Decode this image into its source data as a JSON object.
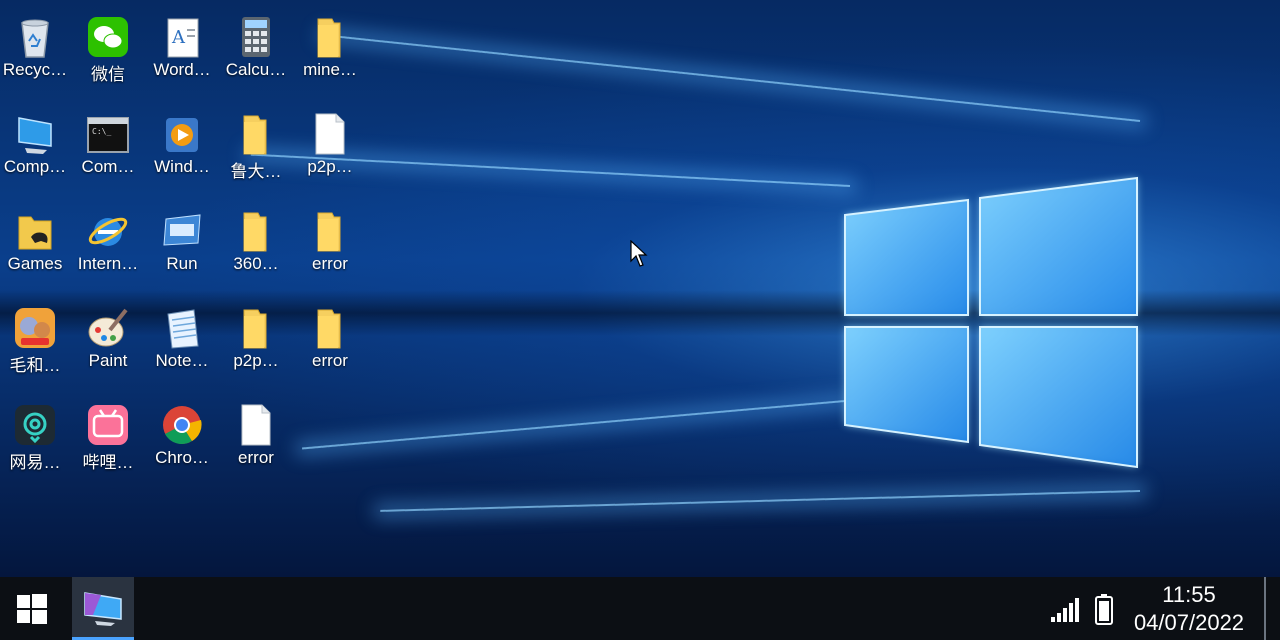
{
  "desktop": {
    "icons": [
      {
        "label": "Recyc…",
        "icon": "recycle-bin-icon"
      },
      {
        "label": "微信",
        "icon": "wechat-icon"
      },
      {
        "label": "Word…",
        "icon": "wordpad-icon"
      },
      {
        "label": "Calcu…",
        "icon": "calculator-icon"
      },
      {
        "label": "mine…",
        "icon": "folder-icon"
      },
      {
        "label": "Comp…",
        "icon": "computer-icon"
      },
      {
        "label": "Com…",
        "icon": "command-prompt-icon"
      },
      {
        "label": "Wind…",
        "icon": "media-player-icon"
      },
      {
        "label": "鲁大…",
        "icon": "folder-icon"
      },
      {
        "label": "p2p…",
        "icon": "document-icon"
      },
      {
        "label": "Games",
        "icon": "games-folder-icon"
      },
      {
        "label": "Intern…",
        "icon": "internet-explorer-icon"
      },
      {
        "label": "Run",
        "icon": "run-icon"
      },
      {
        "label": "360…",
        "icon": "folder-icon"
      },
      {
        "label": "error",
        "icon": "folder-icon"
      },
      {
        "label": "毛和…",
        "icon": "tom-jerry-game-icon"
      },
      {
        "label": "Paint",
        "icon": "paint-icon"
      },
      {
        "label": "Note…",
        "icon": "notepad-icon"
      },
      {
        "label": "p2p…",
        "icon": "folder-icon"
      },
      {
        "label": "error",
        "icon": "folder-icon"
      },
      {
        "label": "网易…",
        "icon": "netease-icon"
      },
      {
        "label": "哔哩…",
        "icon": "bilibili-icon"
      },
      {
        "label": "Chro…",
        "icon": "chrome-icon"
      },
      {
        "label": "error",
        "icon": "document-icon"
      }
    ]
  },
  "taskbar": {
    "start_icon": "windows-start-icon",
    "active_app_icon": "desktop-app-icon",
    "signal_icon": "cellular-signal-icon",
    "battery_icon": "battery-icon",
    "time": "11:55",
    "date": "04/07/2022"
  },
  "colors": {
    "taskbar": "#0c0f14",
    "accent": "#4aa3ff",
    "wallpaper_dark": "#062a63",
    "wallpaper_light": "#3aa0ff"
  }
}
